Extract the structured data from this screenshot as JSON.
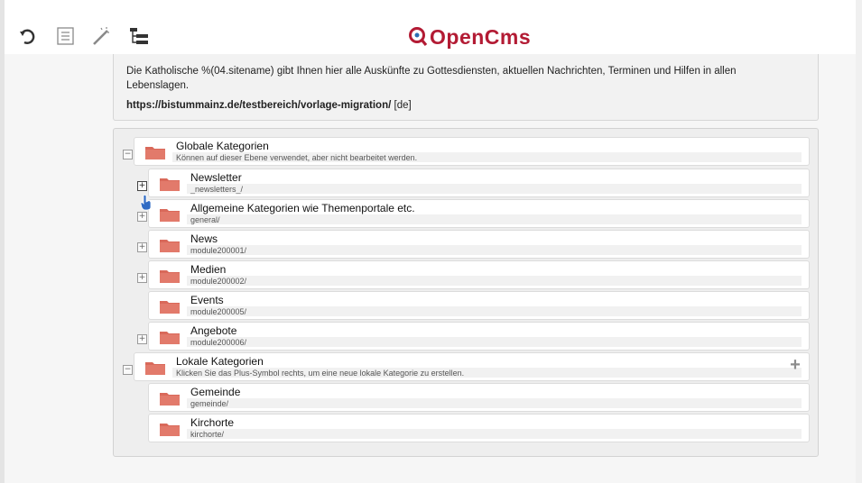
{
  "toolbar": {
    "icons": [
      "refresh-icon",
      "list-icon",
      "magic-wand-icon",
      "sitemap-icon"
    ],
    "logo_text": "OpenCms"
  },
  "info": {
    "description": "Die Katholische %(04.sitename) gibt Ihnen hier alle Auskünfte zu Gottesdiensten, aktuellen Nachrichten, Terminen und Hilfen in allen Lebenslagen.",
    "url": "https://bistummainz.de/testbereich/vorlage-migration/",
    "locale": "[de]"
  },
  "tree": {
    "global": {
      "title": "Globale Kategorien",
      "subtitle": "Können auf dieser Ebene verwendet, aber nicht bearbeitet werden.",
      "toggle": "−"
    },
    "global_items": [
      {
        "title": "Newsletter",
        "path": "_newsletters_/",
        "toggle": "+"
      },
      {
        "title": "Allgemeine Kategorien wie Themenportale etc.",
        "path": "general/",
        "toggle": "+"
      },
      {
        "title": "News",
        "path": "module200001/",
        "toggle": "+"
      },
      {
        "title": "Medien",
        "path": "module200002/",
        "toggle": "+"
      },
      {
        "title": "Events",
        "path": "module200005/",
        "toggle": ""
      },
      {
        "title": "Angebote",
        "path": "module200006/",
        "toggle": "+"
      }
    ],
    "local": {
      "title": "Lokale Kategorien",
      "subtitle": "Klicken Sie das Plus-Symbol rechts, um eine neue lokale Kategorie zu erstellen.",
      "toggle": "−",
      "add_symbol": "+"
    },
    "local_items": [
      {
        "title": "Gemeinde",
        "path": "gemeinde/"
      },
      {
        "title": "Kirchorte",
        "path": "kirchorte/"
      }
    ]
  },
  "colors": {
    "folder": "#d9695a",
    "logo": "#b31b34"
  }
}
